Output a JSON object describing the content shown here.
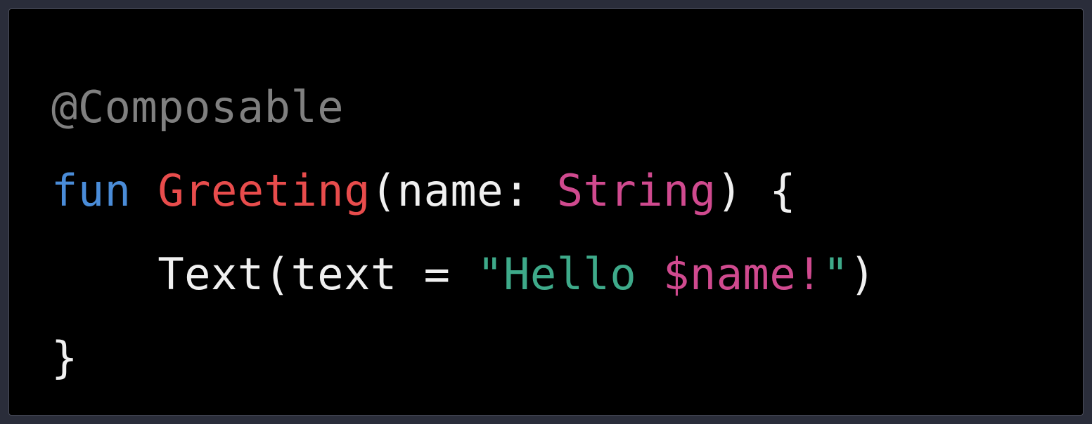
{
  "code": {
    "line1": {
      "annotation": "@Composable"
    },
    "line2": {
      "keyword": "fun",
      "space1": " ",
      "function": "Greeting",
      "paren_open": "(",
      "param_name": "name",
      "colon": ": ",
      "type": "String",
      "paren_close": ")",
      "brace_open": " {"
    },
    "line3": {
      "indent": "    ",
      "call": "Text(text = ",
      "string_open": "\"",
      "string_text": "Hello ",
      "template": "$name",
      "string_excl": "!",
      "string_close": "\"",
      "paren_close": ")"
    },
    "line4": {
      "brace_close": "}"
    }
  }
}
